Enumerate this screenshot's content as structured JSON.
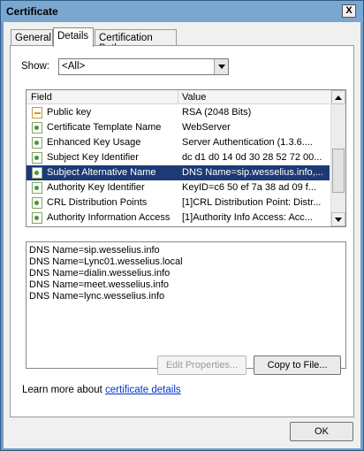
{
  "window": {
    "title": "Certificate",
    "close_glyph": "X"
  },
  "tabs": [
    {
      "label": "General"
    },
    {
      "label": "Details"
    },
    {
      "label": "Certification Path"
    }
  ],
  "show": {
    "label": "Show:",
    "value": "<All>"
  },
  "fields_table": {
    "columns": [
      "Field",
      "Value"
    ],
    "rows": [
      {
        "field": "Public key",
        "value": "RSA (2048 Bits)",
        "icon": "key-icon",
        "selected": false
      },
      {
        "field": "Certificate Template Name",
        "value": "WebServer",
        "icon": "extension-icon",
        "selected": false
      },
      {
        "field": "Enhanced Key Usage",
        "value": "Server Authentication (1.3.6....",
        "icon": "extension-icon",
        "selected": false
      },
      {
        "field": "Subject Key Identifier",
        "value": "dc d1 d0 14 0d 30 28 52 72 00...",
        "icon": "extension-icon",
        "selected": false
      },
      {
        "field": "Subject Alternative Name",
        "value": "DNS Name=sip.wesselius.info,...",
        "icon": "extension-icon",
        "selected": true
      },
      {
        "field": "Authority Key Identifier",
        "value": "KeyID=c6 50 ef 7a 38 ad 09 f...",
        "icon": "extension-icon",
        "selected": false
      },
      {
        "field": "CRL Distribution Points",
        "value": "[1]CRL Distribution Point: Distr...",
        "icon": "extension-icon",
        "selected": false
      },
      {
        "field": "Authority Information Access",
        "value": "[1]Authority Info Access: Acc...",
        "icon": "extension-icon",
        "selected": false
      }
    ]
  },
  "details_box": {
    "lines": [
      "DNS Name=sip.wesselius.info",
      "DNS Name=Lync01.wesselius.local",
      "DNS Name=dialin.wesselius.info",
      "DNS Name=meet.wesselius.info",
      "DNS Name=lync.wesselius.info"
    ]
  },
  "buttons": {
    "edit_properties": "Edit Properties...",
    "copy_to_file": "Copy to File...",
    "ok": "OK"
  },
  "learn_more": {
    "prefix": "Learn more about ",
    "link": "certificate details"
  },
  "colors": {
    "selection": "#1b3a76",
    "link": "#0033cc",
    "frame": "#7aa7d0"
  }
}
